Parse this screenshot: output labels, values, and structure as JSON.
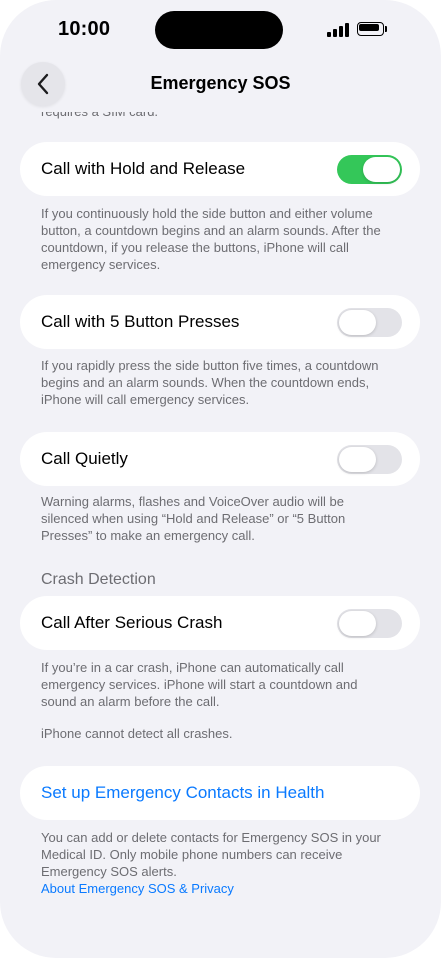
{
  "status_bar": {
    "time": "10:00"
  },
  "nav": {
    "title": "Emergency SOS",
    "back_icon": "chevron-left-icon"
  },
  "top_cut_text": "requires a SIM card.",
  "settings": [
    {
      "label": "Call with Hold and Release",
      "enabled": true,
      "footnote": "If you continuously hold the side button and either volume button, a countdown begins and an alarm sounds. After the countdown, if you release the buttons, iPhone will call emergency services."
    },
    {
      "label": "Call with 5 Button Presses",
      "enabled": false,
      "footnote": "If you rapidly press the side button five times, a countdown begins and an alarm sounds. When the countdown ends, iPhone will call emergency services."
    },
    {
      "label": "Call Quietly",
      "enabled": false,
      "footnote": "Warning alarms, flashes and VoiceOver audio will be silenced when using “Hold and Release” or “5 Button Presses” to make an emergency call."
    }
  ],
  "crash_detection": {
    "header": "Crash Detection",
    "label": "Call After Serious Crash",
    "enabled": false,
    "footnote": "If you’re in a car crash, iPhone can automatically call emergency services. iPhone will start a countdown and sound an alarm before the call.",
    "footnote2": "iPhone cannot detect all crashes."
  },
  "contacts": {
    "link_label": "Set up Emergency Contacts in Health",
    "footnote": "You can add or delete contacts for Emergency SOS in your Medical ID. Only mobile phone numbers can receive Emergency SOS alerts.",
    "privacy_link": "About Emergency SOS & Privacy"
  },
  "colors": {
    "accent": "#0a7aff",
    "toggle_on": "#34c759",
    "toggle_off": "#e3e3e8",
    "background": "#f2f2f7",
    "secondary_text": "#6d6d72"
  }
}
